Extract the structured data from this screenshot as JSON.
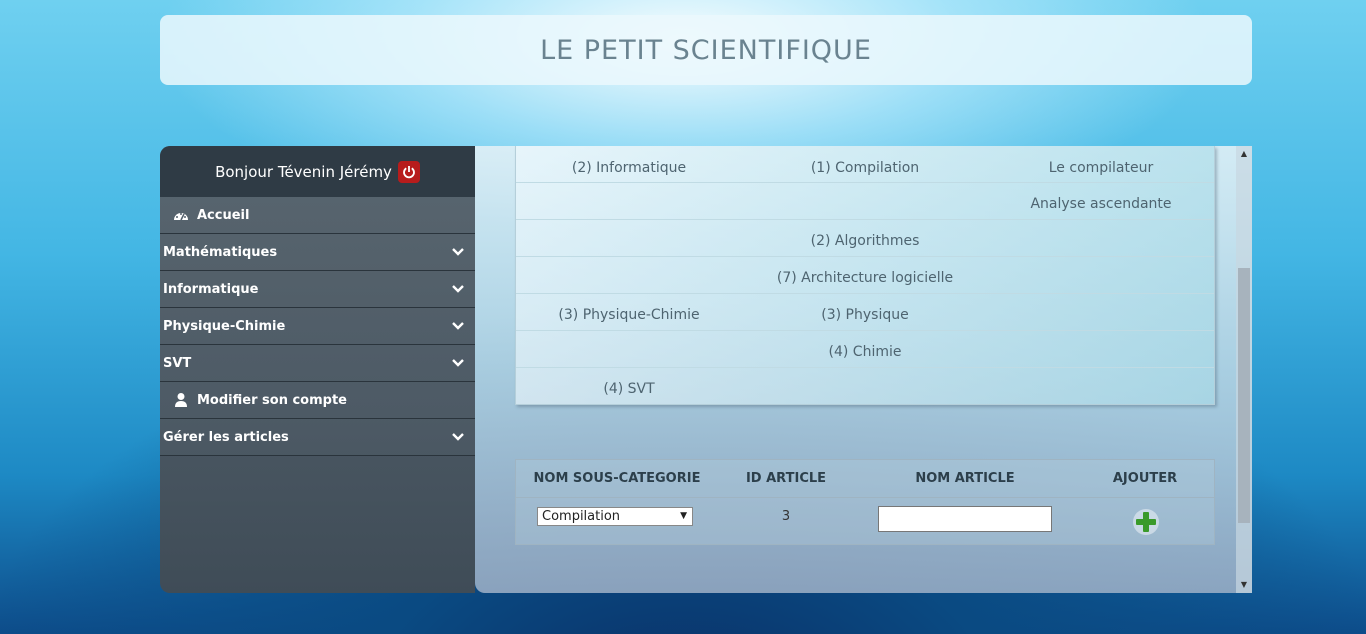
{
  "header": {
    "title": "LE PETIT SCIENTIFIQUE"
  },
  "sidebar": {
    "greeting": "Bonjour Tévenin Jérémy",
    "items": [
      {
        "label": "Accueil",
        "icon": "dashboard-icon"
      },
      {
        "label": "Mathématiques",
        "icon": "chevron-down-icon"
      },
      {
        "label": "Informatique",
        "icon": "chevron-down-icon"
      },
      {
        "label": "Physique-Chimie",
        "icon": "chevron-down-icon"
      },
      {
        "label": "SVT",
        "icon": "chevron-down-icon"
      },
      {
        "label": "Modifier son compte",
        "icon": "user-icon"
      },
      {
        "label": "Gérer les articles",
        "icon": "chevron-down-icon"
      }
    ]
  },
  "category_table": {
    "rows": [
      {
        "category": "(2) Informatique",
        "subcategory": "(1) Compilation",
        "article": "Le compilateur"
      },
      {
        "category": "",
        "subcategory": "",
        "article": "Analyse ascendante"
      },
      {
        "category": "",
        "subcategory": "(2) Algorithmes",
        "article": ""
      },
      {
        "category": "",
        "subcategory": "(7) Architecture logicielle",
        "article": ""
      },
      {
        "category": "(3) Physique-Chimie",
        "subcategory": "(3) Physique",
        "article": ""
      },
      {
        "category": "",
        "subcategory": "(4) Chimie",
        "article": ""
      },
      {
        "category": "(4) SVT",
        "subcategory": "",
        "article": ""
      }
    ]
  },
  "add_form": {
    "headers": {
      "subcategory": "NOM SOUS-CATEGORIE",
      "id": "ID ARTICLE",
      "name": "NOM ARTICLE",
      "add": "AJOUTER"
    },
    "selected_subcategory": "Compilation",
    "id_value": "3",
    "name_value": ""
  },
  "colors": {
    "add_icon": "#3a9a2a",
    "power_icon": "#b71c1c"
  }
}
